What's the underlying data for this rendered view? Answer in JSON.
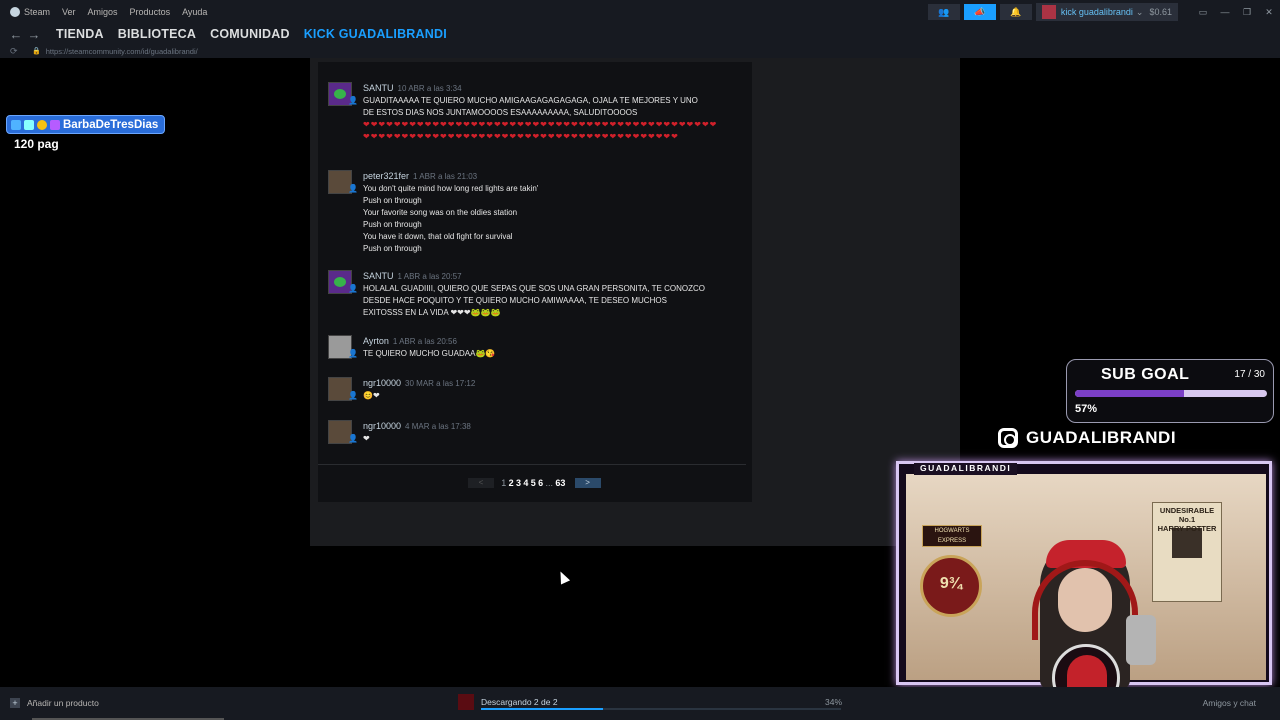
{
  "menubar": {
    "app": "Steam",
    "items": [
      "Ver",
      "Amigos",
      "Productos",
      "Ayuda"
    ],
    "account_name": "kick guadalibrandi",
    "balance": "$0.61"
  },
  "nav": {
    "items": [
      "TIENDA",
      "BIBLIOTECA",
      "COMUNIDAD",
      "KICK GUADALIBRANDI"
    ],
    "url": "https://steamcommunity.com/id/guadalibrandi/"
  },
  "comments": [
    {
      "author": "SANTU",
      "time": "10 ABR a las 3:34",
      "text": "GUADITAAAAA TE QUIERO MUCHO AMIGAAGAGAGAGAGA, OJALA TE MEJORES Y UNO\nDE ESTOS DIAS NOS JUNTAMOOOOS ESAAAAAAAAA, SALUDITOOOOS",
      "hearts": "❤❤❤❤❤❤❤❤❤❤❤❤❤❤❤❤❤❤❤❤❤❤❤❤❤❤❤❤❤❤❤❤❤❤❤❤❤❤❤❤❤❤❤❤❤❤❤❤❤❤❤❤❤❤❤❤❤❤❤❤❤❤❤❤❤❤❤❤❤❤❤❤❤❤❤❤❤❤❤❤❤❤❤❤❤❤❤"
    },
    {
      "author": "peter321fer",
      "time": "1 ABR a las 21:03",
      "text": "You don't quite mind how long red lights are takin'\nPush on through\nYour favorite song was on the oldies station\nPush on through\nYou have it down, that old fight for survival\nPush on through"
    },
    {
      "author": "SANTU",
      "time": "1 ABR a las 20:57",
      "text": "HOLALAL GUADIIII, QUIERO QUE SEPAS QUE SOS UNA GRAN PERSONITA, TE CONOZCO\nDESDE HACE POQUITO Y TE QUIERO MUCHO AMIWAAAA, TE DESEO MUCHOS\nEXITOSSS EN LA VIDA ❤❤❤🐸🐸🐸"
    },
    {
      "author": "Ayrton",
      "time": "1 ABR a las 20:56",
      "text": "TE QUIERO MUCHO GUADAA🐸😘"
    },
    {
      "author": "ngr10000",
      "time": "30 MAR a las 17:12",
      "text": "😊❤"
    },
    {
      "author": "ngr10000",
      "time": "4 MAR a las 17:38",
      "text": "❤"
    }
  ],
  "pager": {
    "prev": "<",
    "next": ">",
    "pages": [
      "1",
      "2",
      "3",
      "4",
      "5",
      "6",
      "...",
      "63"
    ]
  },
  "overlay": {
    "badge_name": "BarbaDeTresDias",
    "pages_text": "120 pag",
    "sub_goal_title": "SUB GOAL",
    "sub_goal_count": "17 / 30",
    "sub_goal_pct_text": "57%",
    "sub_goal_fraction": 0.57,
    "instagram": "GUADALIBRANDI",
    "cam_label": "GUADALIBRANDI",
    "poster_text": "UNDESIRABLE\nNo.1\nHARRY POTTER",
    "platform_text": "9¾",
    "sign_text": "HOGWARTS EXPRESS"
  },
  "bottombar": {
    "add_product": "Añadir un producto",
    "download_text": "Descargando 2 de 2",
    "download_pct": "34%",
    "download_fraction": 0.34,
    "friends": "Amigos y chat"
  }
}
